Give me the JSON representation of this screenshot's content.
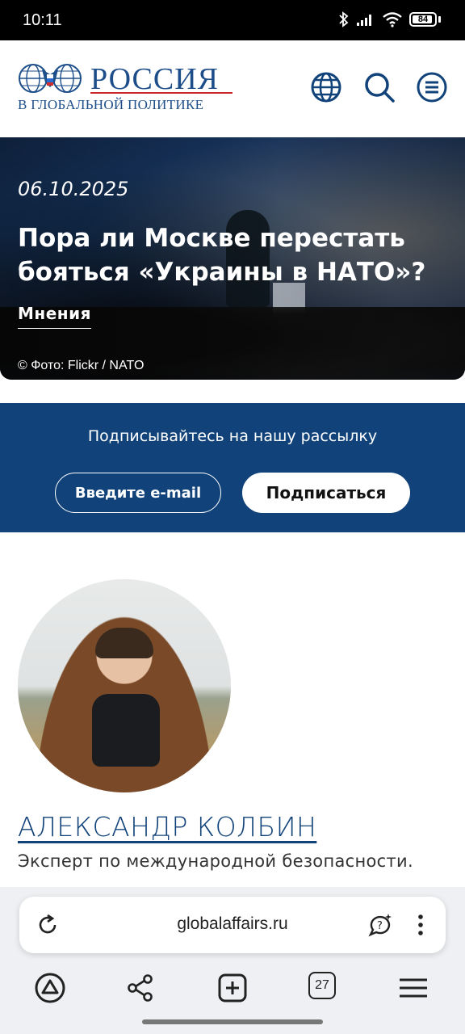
{
  "status_bar": {
    "time": "10:11",
    "battery": "84"
  },
  "site": {
    "logo_title": "РОССИЯ",
    "logo_subtitle": "В ГЛОБАЛЬНОЙ ПОЛИТИКЕ",
    "brand_color": "#1d4e8a"
  },
  "hero": {
    "date": "06.10.2025",
    "headline": "Пора ли Москве перестать бояться «Украины в НАТО»?",
    "category": "Мнения",
    "photo_credit": "© Фото: Flickr / NATO"
  },
  "newsletter": {
    "title": "Подписывайтесь на нашу рассылку",
    "email_placeholder": "Введите e-mail",
    "subscribe_label": "Подписаться",
    "background_color": "#11437a"
  },
  "author": {
    "name": "АЛЕКСАНДР КОЛБИН",
    "description": "Эксперт по международной безопасности."
  },
  "browser": {
    "url": "globalaffairs.ru",
    "tab_count": "27",
    "icons": [
      "reload-icon",
      "ai-assistant-icon",
      "more-menu-icon",
      "home-alice-icon",
      "share-icon",
      "new-tab-icon",
      "tabs-icon",
      "menu-icon"
    ]
  }
}
